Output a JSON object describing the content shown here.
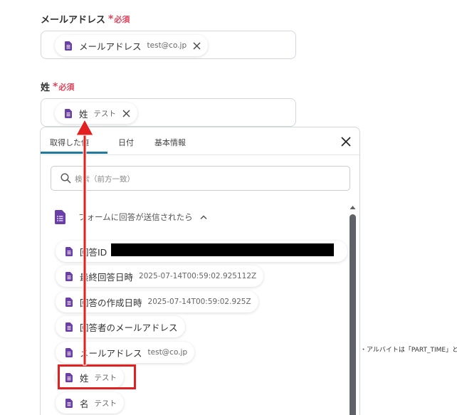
{
  "fields": {
    "email": {
      "label": "メールアドレス",
      "required": "必須",
      "chip": {
        "name": "メールアドレス",
        "value": "test@co.jp"
      }
    },
    "lastname": {
      "label": "姓",
      "required": "必須",
      "chip": {
        "name": "姓",
        "value": "テスト"
      }
    }
  },
  "popup": {
    "tabs": [
      "取得した値",
      "日付",
      "基本情報"
    ],
    "search_placeholder": "検索（前方一致）",
    "section_title": "フォームに回答が送信されたら",
    "items": [
      {
        "name": "回答ID",
        "value": ""
      },
      {
        "name": "最終回答日時",
        "value": "2025-07-14T00:59:02.925112Z"
      },
      {
        "name": "回答の作成日時",
        "value": "2025-07-14T00:59:02.925Z"
      },
      {
        "name": "回答者のメールアドレス",
        "value": ""
      },
      {
        "name": "メールアドレス",
        "value": "test@co.jp"
      },
      {
        "name": "姓",
        "value": "テスト"
      },
      {
        "name": "名",
        "value": "テスト"
      }
    ]
  },
  "side_note": "・アルバイトは「PART_TIME」と",
  "colors": {
    "accent_tab": "#1e7a9f",
    "required": "#e0435c",
    "doc_icon": "#6b3fa8",
    "highlight": "#e1201f"
  }
}
